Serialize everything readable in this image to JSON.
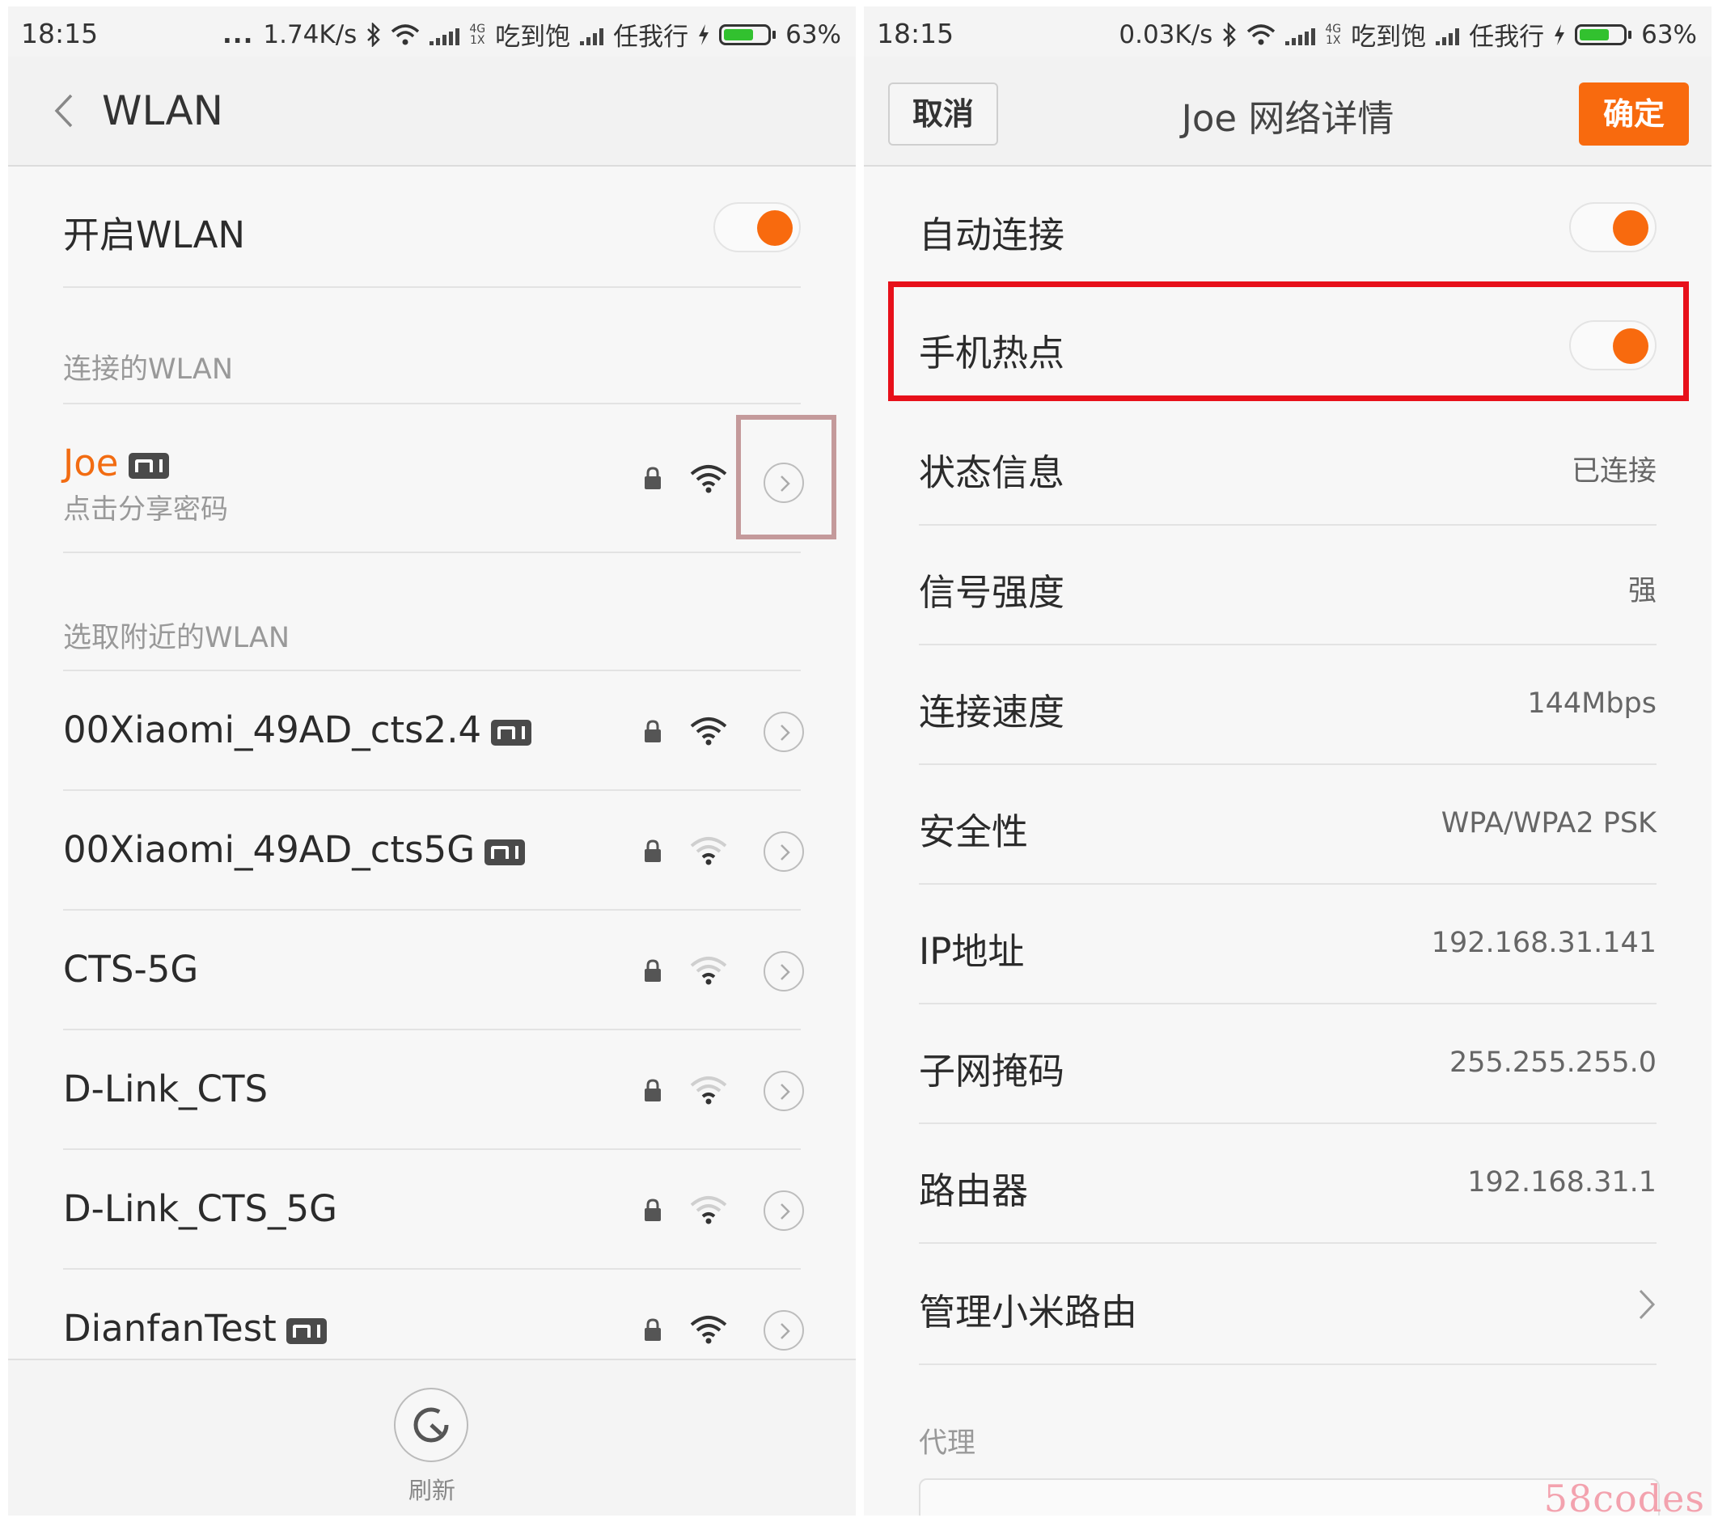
{
  "left": {
    "status": {
      "time": "18:15",
      "speed": "1.74K/s",
      "carrier1": "吃到饱",
      "carrier2": "任我行",
      "battery": "63%",
      "dots": "...",
      "net_top": "4G",
      "net_bottom": "1X"
    },
    "header": {
      "title": "WLAN"
    },
    "wlan_toggle": {
      "label": "开启WLAN",
      "on": true
    },
    "connected_section": "连接的WLAN",
    "connected": {
      "ssid": "Joe",
      "subtitle": "点击分享密码",
      "accent_color": "#f26c12"
    },
    "nearby_section": "选取附近的WLAN",
    "networks": [
      {
        "ssid": "00Xiaomi_49AD_cts2.4",
        "mi": true,
        "signal": "strong"
      },
      {
        "ssid": "00Xiaomi_49AD_cts5G",
        "mi": true,
        "signal": "weak"
      },
      {
        "ssid": "CTS-5G",
        "mi": false,
        "signal": "weak"
      },
      {
        "ssid": "D-Link_CTS",
        "mi": false,
        "signal": "weak"
      },
      {
        "ssid": "D-Link_CTS_5G",
        "mi": false,
        "signal": "weak"
      },
      {
        "ssid": "DianfanTest",
        "mi": true,
        "signal": "strong"
      }
    ],
    "refresh_label": "刷新"
  },
  "right": {
    "status": {
      "time": "18:15",
      "speed": "0.03K/s",
      "carrier1": "吃到饱",
      "carrier2": "任我行",
      "battery": "63%",
      "net_top": "4G",
      "net_bottom": "1X"
    },
    "header": {
      "cancel": "取消",
      "title": "Joe 网络详情",
      "ok": "确定"
    },
    "auto_connect": {
      "label": "自动连接",
      "on": true
    },
    "hotspot": {
      "label": "手机热点",
      "on": true
    },
    "details": [
      {
        "label": "状态信息",
        "value": "已连接"
      },
      {
        "label": "信号强度",
        "value": "强"
      },
      {
        "label": "连接速度",
        "value": "144Mbps"
      },
      {
        "label": "安全性",
        "value": "WPA/WPA2 PSK"
      },
      {
        "label": "IP地址",
        "value": "192.168.31.141"
      },
      {
        "label": "子网掩码",
        "value": "255.255.255.0"
      },
      {
        "label": "路由器",
        "value": "192.168.31.1"
      }
    ],
    "manage_router": "管理小米路由",
    "proxy_section": "代理"
  },
  "watermark": "58codes",
  "colors": {
    "accent": "#f86a0e",
    "highlight_pink": "#c49a9b",
    "highlight_red": "#e7101a",
    "battery": "#32c12f"
  }
}
